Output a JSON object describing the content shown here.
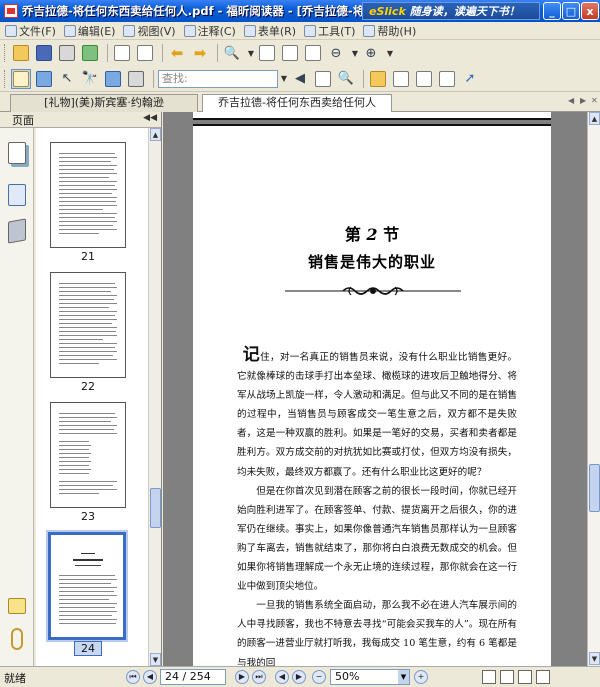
{
  "window": {
    "title": "乔吉拉德-将任何东西卖给任何人.pdf - 福昕阅读器 - [乔吉拉德-将任何东西卖给任何人.pdf]",
    "ad_brand": "eSlick",
    "ad_text": "随身读，读遍天下书！",
    "minimize": "_",
    "restore": "□",
    "close": "x"
  },
  "menu": {
    "items": [
      "文件(F)",
      "编辑(E)",
      "视图(V)",
      "注释(C)",
      "表单(R)",
      "工具(T)",
      "帮助(H)"
    ]
  },
  "toolbar": {
    "search_placeholder": "查找:"
  },
  "tabs": [
    {
      "label": "[礼物](美)斯宾塞·约翰逊"
    },
    {
      "label": "乔吉拉德-将任何东西卖给任何人"
    }
  ],
  "sidepanel": {
    "header": "页面",
    "thumbs": [
      {
        "label": "21"
      },
      {
        "label": "22"
      },
      {
        "label": "23"
      },
      {
        "label": "24"
      }
    ]
  },
  "document": {
    "chapter_prefix": "第",
    "chapter_num": "2",
    "chapter_suffix": "节",
    "chapter_title": "销售是伟大的职业",
    "dropcap": "记",
    "paragraphs": [
      "住，对一名真正的销售员来说，没有什么职业比销售更好。它就像棒球的击球手打出本垒球、橄榄球的进攻后卫触地得分、将军从战场上凯旋一样，令人激动和满足。但与此又不同的是在销售的过程中，当销售员与顾客成交一笔生意之后，双方都不是失败者，这是一种双赢的胜利。如果是一笔好的交易，买者和卖者都是胜利方。双方成交前的对抗犹如比赛或打仗，但双方均没有损失，均未失败，最终双方都赢了。还有什么职业比这更好的呢？",
      "但是在你首次见到潜在顾客之前的很长一段时间，你就已经开始向胜利进军了。在顾客签单、付款、提货离开之后很久，你的进军仍在继续。事实上，如果你像普通汽车销售员那样认为一旦顾客购了车离去，销售就结束了，那你将白白浪费无数成交的机会。但如果你将销售理解成一个永无止境的连续过程，那你就会在这一行业中做到顶尖地位。",
      "一旦我的销售系统全面启动，那么我不必在进人汽车展示间的人中寻找顾客，我也不特意去寻找“可能会买我车的人”。现在所有的顾客一进营业厅就打听我，我每成交 10 笔生意，约有 6 笔都是与我的回"
    ]
  },
  "statusbar": {
    "status": "就绪",
    "page_indicator": "24 / 254",
    "zoom": "50%"
  }
}
